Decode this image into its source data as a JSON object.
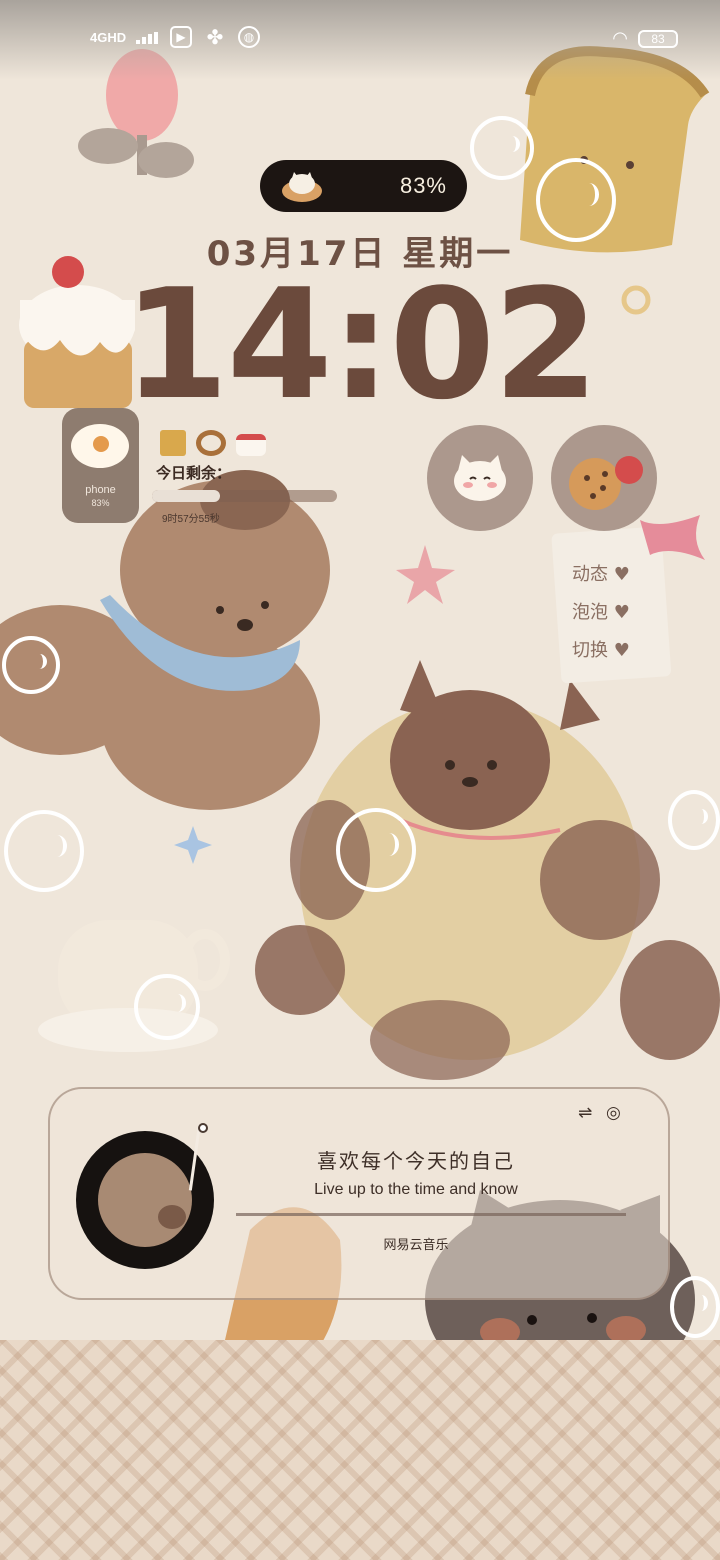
{
  "status_bar": {
    "network": "4GHD",
    "battery": "83"
  },
  "widget_pill": {
    "percent": "83%"
  },
  "lock": {
    "date": "03月17日 星期一",
    "time": "14:02"
  },
  "phone_battery": {
    "name": "phone",
    "percent": "83%"
  },
  "remaining": {
    "title": "今日剩余：",
    "time": "9时57分55秒",
    "fill_fraction": 0.37
  },
  "stickers": {
    "note": [
      "动态",
      "泡泡",
      "切换"
    ]
  },
  "music": {
    "song_title": "喜欢每个今天的自己",
    "lyric": "Live up to the time and know",
    "app_name": "网易云音乐"
  },
  "colors": {
    "wallpaper": "#efe6da",
    "text_brown": "#6b4a3c",
    "pill_dark": "#1c1512"
  }
}
